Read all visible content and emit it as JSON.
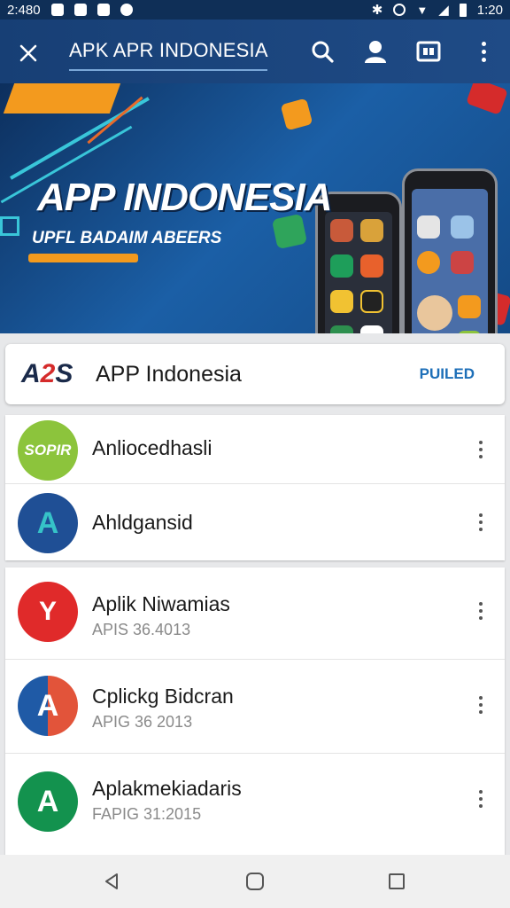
{
  "status_bar": {
    "time_left": "2:480",
    "time_right": "1:20"
  },
  "app_bar": {
    "title": "APK APR INDONESIA",
    "icons": [
      "close-icon",
      "search-icon",
      "account-icon",
      "tabs-icon",
      "more-vert-icon"
    ]
  },
  "hero": {
    "title": "APP INDONESIA",
    "subtitle": "UPFL BADAIM ABEERS"
  },
  "app_header": {
    "logo_text_a": "A",
    "logo_text_b": "2",
    "logo_text_c": "S",
    "name": "APP Indonesia",
    "publisher": "PUILED"
  },
  "list_top": [
    {
      "title": "Anliocedhasli",
      "icon_text": "SOPIR",
      "icon_color": "#8cc43c"
    },
    {
      "title": "Ahldgansid",
      "icon_text": "A",
      "icon_color": "#1f4f95"
    }
  ],
  "list_bottom": [
    {
      "title": "Aplik Niwamias",
      "subtitle": "APIS 36.4013",
      "icon_text": "Y",
      "icon_color": "#e02a2a"
    },
    {
      "title": "Cplickg Bidcran",
      "subtitle": "APIG 36 2013",
      "icon_text": "A",
      "icon_color": "#e2543a"
    },
    {
      "title": "Aplakmekiadaris",
      "subtitle": "FAPIG 31:2015",
      "icon_text": "A",
      "icon_color": "#13924e"
    }
  ],
  "nav_bar": {
    "icons": [
      "back-icon",
      "home-icon",
      "recents-icon"
    ]
  }
}
